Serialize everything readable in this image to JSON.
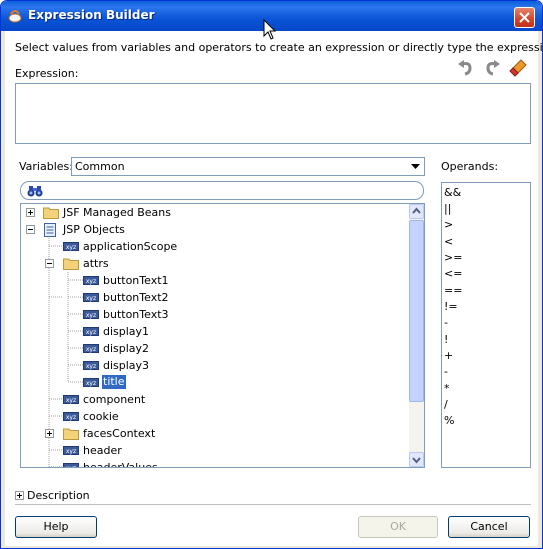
{
  "window": {
    "title": "Expression Builder"
  },
  "instruction": "Select values from variables and operators to create an expression or directly type the expression here:",
  "expression": {
    "label": "Expression:",
    "value": ""
  },
  "toolbar": {
    "icons": [
      "undo-icon",
      "redo-icon",
      "clear-icon"
    ]
  },
  "variables": {
    "label": "Variables:",
    "selected": "Common"
  },
  "operands": {
    "label": "Operands:",
    "items": [
      "&&",
      "||",
      ">",
      "<",
      ">=",
      "<=",
      "==",
      "!=",
      "-",
      "!",
      "+",
      "-",
      "*",
      "/",
      "%"
    ]
  },
  "tree": {
    "rows": [
      {
        "label": "JSF Managed Beans",
        "icon": "folder-icon",
        "expander": "plus",
        "level": 0
      },
      {
        "label": "JSP Objects",
        "icon": "jsp-objects-icon",
        "expander": "minus",
        "level": 0
      },
      {
        "label": "applicationScope",
        "icon": "variable-icon",
        "expander": "none",
        "level": 1
      },
      {
        "label": "attrs",
        "icon": "folder-icon",
        "expander": "minus",
        "level": 1
      },
      {
        "label": "buttonText1",
        "icon": "variable-icon",
        "expander": "none",
        "level": 2
      },
      {
        "label": "buttonText2",
        "icon": "variable-icon",
        "expander": "none",
        "level": 2
      },
      {
        "label": "buttonText3",
        "icon": "variable-icon",
        "expander": "none",
        "level": 2
      },
      {
        "label": "display1",
        "icon": "variable-icon",
        "expander": "none",
        "level": 2
      },
      {
        "label": "display2",
        "icon": "variable-icon",
        "expander": "none",
        "level": 2
      },
      {
        "label": "display3",
        "icon": "variable-icon",
        "expander": "none",
        "level": 2
      },
      {
        "label": "title",
        "icon": "variable-icon",
        "expander": "none",
        "level": 2,
        "selected": true
      },
      {
        "label": "component",
        "icon": "variable-icon",
        "expander": "none",
        "level": 1
      },
      {
        "label": "cookie",
        "icon": "variable-icon",
        "expander": "none",
        "level": 1
      },
      {
        "label": "facesContext",
        "icon": "folder-icon",
        "expander": "plus",
        "level": 1
      },
      {
        "label": "header",
        "icon": "variable-icon",
        "expander": "none",
        "level": 1
      },
      {
        "label": "headerValues",
        "icon": "variable-icon",
        "expander": "none",
        "level": 1
      }
    ]
  },
  "description": {
    "label": "Description"
  },
  "buttons": {
    "help": "Help",
    "ok": "OK",
    "cancel": "Cancel"
  },
  "colors": {
    "titlebar": "#0a5fd8",
    "selection": "#316ac5",
    "folder": "#f4d27a"
  }
}
